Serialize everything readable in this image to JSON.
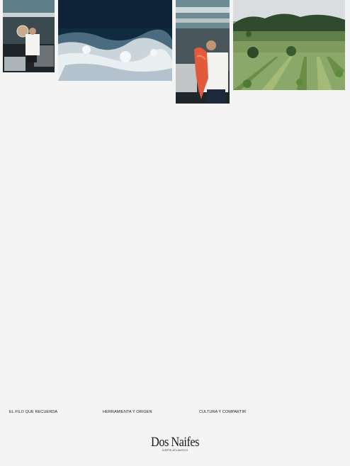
{
  "gallery": {
    "photos": [
      {
        "name": "chef-kitchen"
      },
      {
        "name": "sea-foam"
      },
      {
        "name": "chef-with-fish"
      },
      {
        "name": "vineyard"
      }
    ]
  },
  "nav": {
    "items": [
      {
        "label": "EL FILO QUE RECUERDA"
      },
      {
        "label": "HERRAMIENTA Y ORIGEN"
      },
      {
        "label": "CULTURA Y  COMPARTIR"
      }
    ]
  },
  "brand": {
    "name": "Dos Naifes",
    "tagline": "CORTE ATLANTICO"
  },
  "colors": {
    "background": "#f4f4f4",
    "text": "#1b1b1b"
  }
}
